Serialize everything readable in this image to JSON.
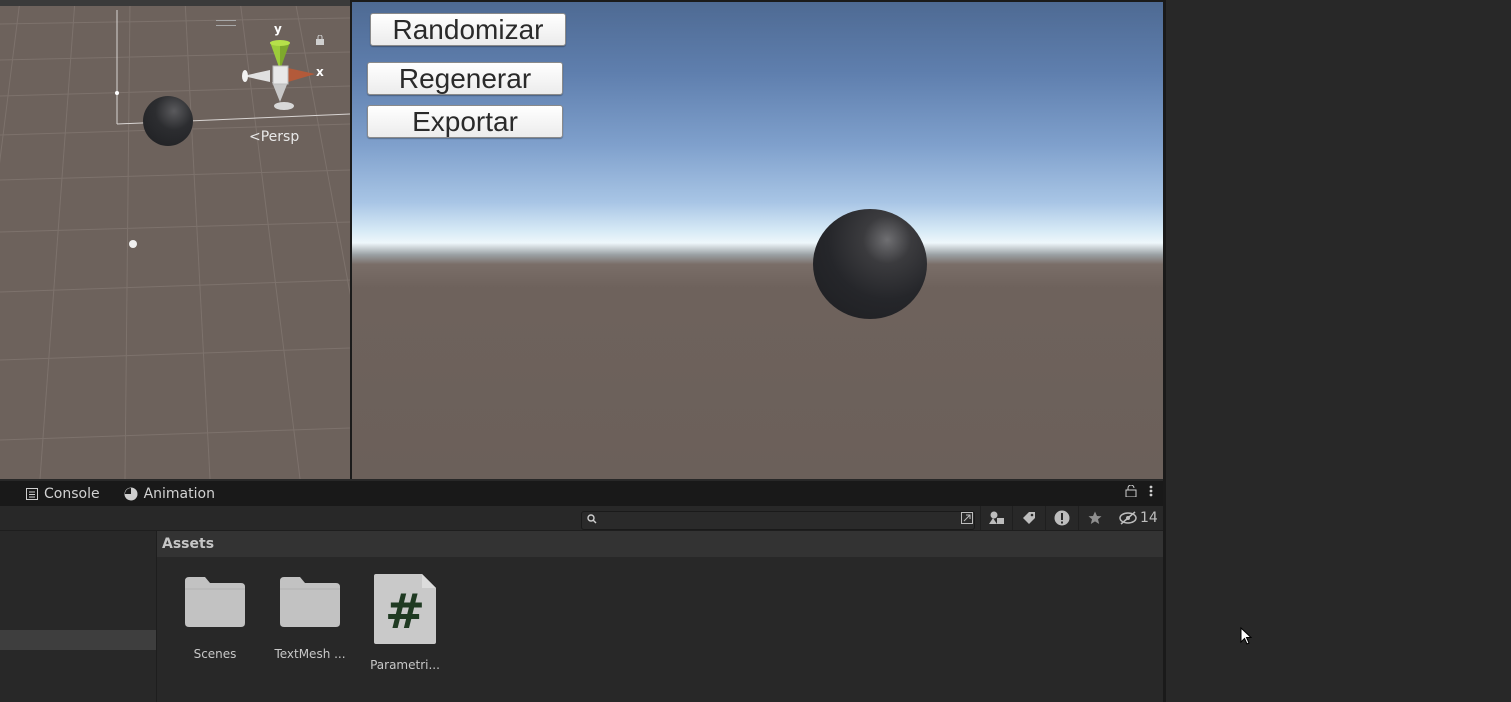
{
  "scene_view": {
    "persp_label": "Persp",
    "axis_y": "y",
    "axis_x": "x"
  },
  "game_view": {
    "buttons": [
      "Randomizar",
      "Regenerar",
      "Exportar"
    ]
  },
  "bottom_panel": {
    "tabs": [
      {
        "label": "Console",
        "icon": "console-icon"
      },
      {
        "label": "Animation",
        "icon": "animation-clock-icon"
      }
    ],
    "search": {
      "placeholder": "",
      "value": ""
    },
    "hidden_count": "14",
    "assets_header": "Assets",
    "assets": [
      {
        "label": "Scenes",
        "icon": "folder-icon"
      },
      {
        "label": "TextMesh ...",
        "icon": "folder-icon"
      },
      {
        "label": "Parametri...",
        "icon": "csharp-script-icon"
      }
    ]
  },
  "colors": {
    "editor_bg": "#282828",
    "scene_ground": "#6d625c",
    "game_sky_top": "#4e6a93",
    "game_horizon": "#eef7fb",
    "game_ground": "#6b605a",
    "script_hash": "#1f3a22"
  }
}
